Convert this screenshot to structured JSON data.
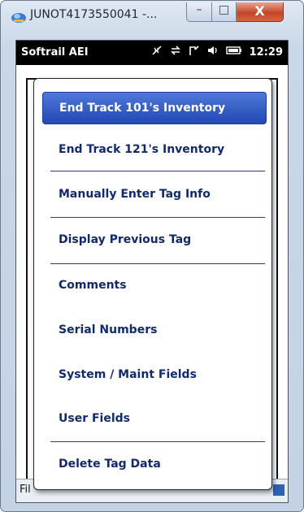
{
  "window": {
    "title": "JUNOT4173550041 -...",
    "minimize_label": "–",
    "maximize_label": "□",
    "close_label": "X"
  },
  "status": {
    "app_name": "Softrail AEI",
    "icons": [
      "connectivity-icon",
      "sync-icon",
      "phone-icon",
      "volume-icon",
      "battery-icon"
    ],
    "time": "12:29"
  },
  "bottom_bar": {
    "label": "Fil"
  },
  "menu": {
    "items": [
      {
        "label": "End Track 101's Inventory",
        "selected": true
      },
      {
        "label": "End Track 121's Inventory",
        "selected": false
      },
      {
        "label": "Manually Enter Tag Info",
        "selected": false
      },
      {
        "label": "Display Previous Tag",
        "selected": false
      },
      {
        "label": "Comments",
        "selected": false
      },
      {
        "label": "Serial Numbers",
        "selected": false
      },
      {
        "label": "System / Maint Fields",
        "selected": false
      },
      {
        "label": "User Fields",
        "selected": false
      },
      {
        "label": "Delete Tag Data",
        "selected": false
      }
    ]
  },
  "colors": {
    "menu_text": "#102a6b",
    "selected_bg": "#2f5ccc",
    "statusbar_bg": "#000000"
  }
}
